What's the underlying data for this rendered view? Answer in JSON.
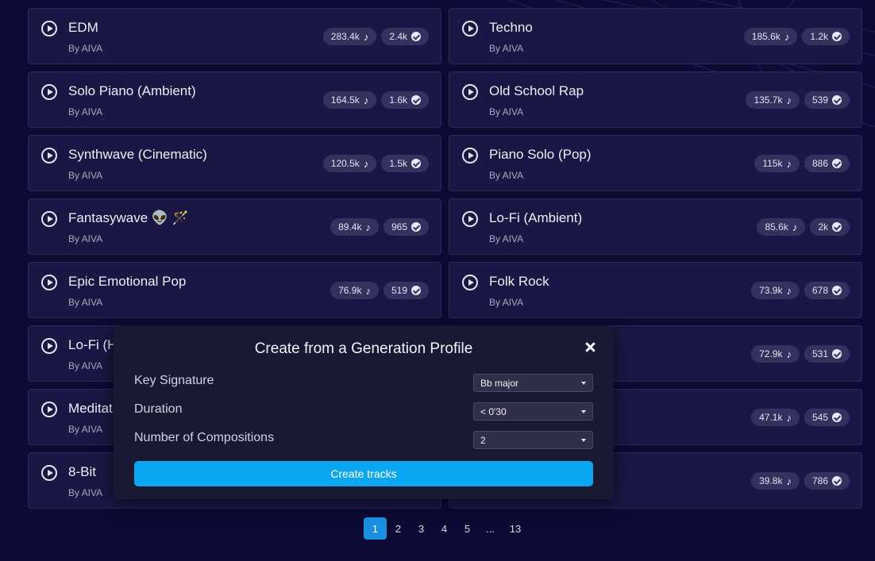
{
  "profiles": [
    {
      "title": "EDM",
      "by": "By AIVA",
      "plays": "283.4k",
      "likes": "2.4k"
    },
    {
      "title": "Techno",
      "by": "By AIVA",
      "plays": "185.6k",
      "likes": "1.2k"
    },
    {
      "title": "Solo Piano (Ambient)",
      "by": "By AIVA",
      "plays": "164.5k",
      "likes": "1.6k"
    },
    {
      "title": "Old School Rap",
      "by": "By AIVA",
      "plays": "135.7k",
      "likes": "539"
    },
    {
      "title": "Synthwave (Cinematic)",
      "by": "By AIVA",
      "plays": "120.5k",
      "likes": "1.5k"
    },
    {
      "title": "Piano Solo (Pop)",
      "by": "By AIVA",
      "plays": "115k",
      "likes": "886"
    },
    {
      "title": "Fantasywave 👽 🪄",
      "by": "By AIVA",
      "plays": "89.4k",
      "likes": "965"
    },
    {
      "title": "Lo-Fi (Ambient)",
      "by": "By AIVA",
      "plays": "85.6k",
      "likes": "2k"
    },
    {
      "title": "Epic Emotional Pop",
      "by": "By AIVA",
      "plays": "76.9k",
      "likes": "519"
    },
    {
      "title": "Folk Rock",
      "by": "By AIVA",
      "plays": "73.9k",
      "likes": "678"
    },
    {
      "title": "Lo-Fi (H",
      "by": "By AIVA",
      "plays": "",
      "likes": ""
    },
    {
      "title": "",
      "by": "",
      "plays": "72.9k",
      "likes": "531"
    },
    {
      "title": "Meditat",
      "by": "By AIVA",
      "plays": "",
      "likes": ""
    },
    {
      "title": "",
      "by": "",
      "plays": "47.1k",
      "likes": "545"
    },
    {
      "title": "8-Bit",
      "by": "By AIVA",
      "plays": "",
      "likes": ""
    },
    {
      "title": "",
      "by": "",
      "plays": "39.8k",
      "likes": "786"
    }
  ],
  "pagination": {
    "pages": [
      "1",
      "2",
      "3",
      "4",
      "5",
      "...",
      "13"
    ],
    "active": "1"
  },
  "modal": {
    "title": "Create from a Generation Profile",
    "fields": [
      {
        "label": "Key Signature",
        "value": "Bb major"
      },
      {
        "label": "Duration",
        "value": "< 0'30"
      },
      {
        "label": "Number of Compositions",
        "value": "2"
      }
    ],
    "submit_label": "Create tracks"
  },
  "icons": {
    "play": "play-circle-icon",
    "plays": "music-note-icon",
    "likes": "check-circle-icon",
    "close": "close-icon",
    "caret": "chevron-down-icon"
  },
  "colors": {
    "background": "#0d0a33",
    "card": "#1b1744",
    "pill": "#35315e",
    "accent": "#0aa6f2",
    "pager_active": "#1d8fe0",
    "modal": "#1a1934"
  }
}
